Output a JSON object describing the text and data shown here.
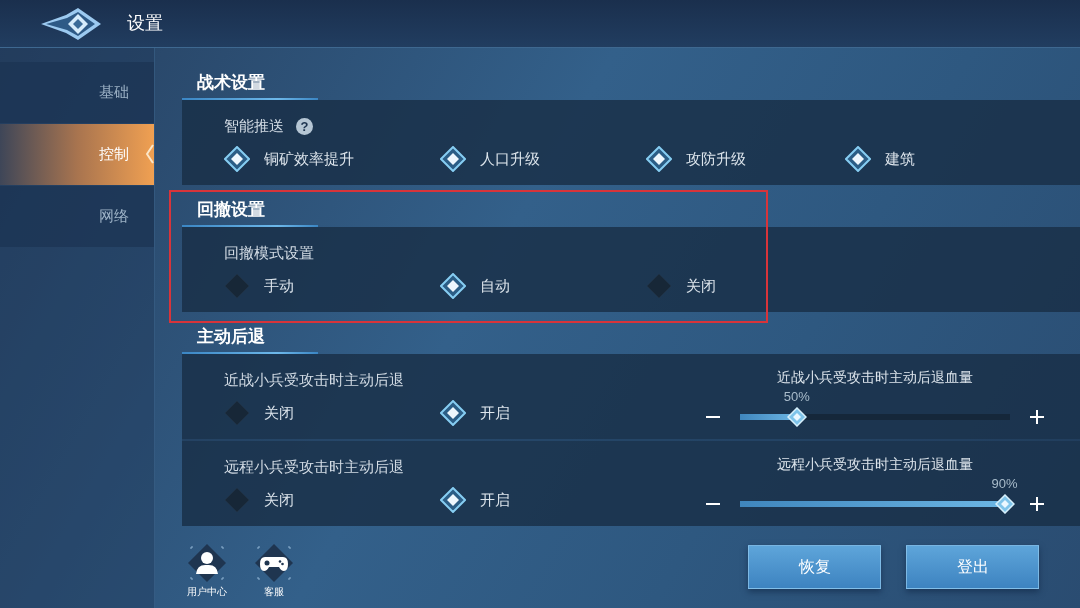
{
  "header": {
    "title": "设置"
  },
  "sidebar": {
    "items": [
      {
        "label": "基础",
        "selected": false
      },
      {
        "label": "控制",
        "selected": true
      },
      {
        "label": "网络",
        "selected": false
      }
    ]
  },
  "sections": [
    {
      "title": "战术设置",
      "highlighted": false,
      "rows": [
        {
          "kind": "choice",
          "label": "智能推送",
          "help": "?",
          "options": [
            {
              "label": "铜矿效率提升",
              "checked": true
            },
            {
              "label": "人口升级",
              "checked": true
            },
            {
              "label": "攻防升级",
              "checked": true
            },
            {
              "label": "建筑",
              "checked": true
            }
          ]
        }
      ]
    },
    {
      "title": "回撤设置",
      "highlighted": true,
      "rows": [
        {
          "kind": "choice",
          "label": "回撤模式设置",
          "options": [
            {
              "label": "手动",
              "selected": false
            },
            {
              "label": "自动",
              "selected": true
            },
            {
              "label": "关闭",
              "selected": false
            }
          ]
        }
      ]
    },
    {
      "title": "主动后退",
      "highlighted": false,
      "rows": [
        {
          "kind": "choice_slider",
          "label": "近战小兵受攻击时主动后退",
          "options": [
            {
              "label": "关闭",
              "selected": false
            },
            {
              "label": "开启",
              "selected": true
            }
          ],
          "slider": {
            "label": "近战小兵受攻击时主动后退血量",
            "reading": "50%",
            "level": 0.21
          }
        },
        {
          "kind": "choice_slider",
          "label": "远程小兵受攻击时主动后退",
          "options": [
            {
              "label": "关闭",
              "selected": false
            },
            {
              "label": "开启",
              "selected": true
            }
          ],
          "slider": {
            "label": "远程小兵受攻击时主动后退血量",
            "reading": "90%",
            "level": 0.98
          }
        }
      ]
    }
  ],
  "footer": {
    "shortcuts": [
      {
        "kind": "user",
        "label": "用户中心"
      },
      {
        "kind": "gamepad",
        "label": "客服"
      }
    ],
    "buttons": [
      "恢复",
      "登出"
    ]
  }
}
